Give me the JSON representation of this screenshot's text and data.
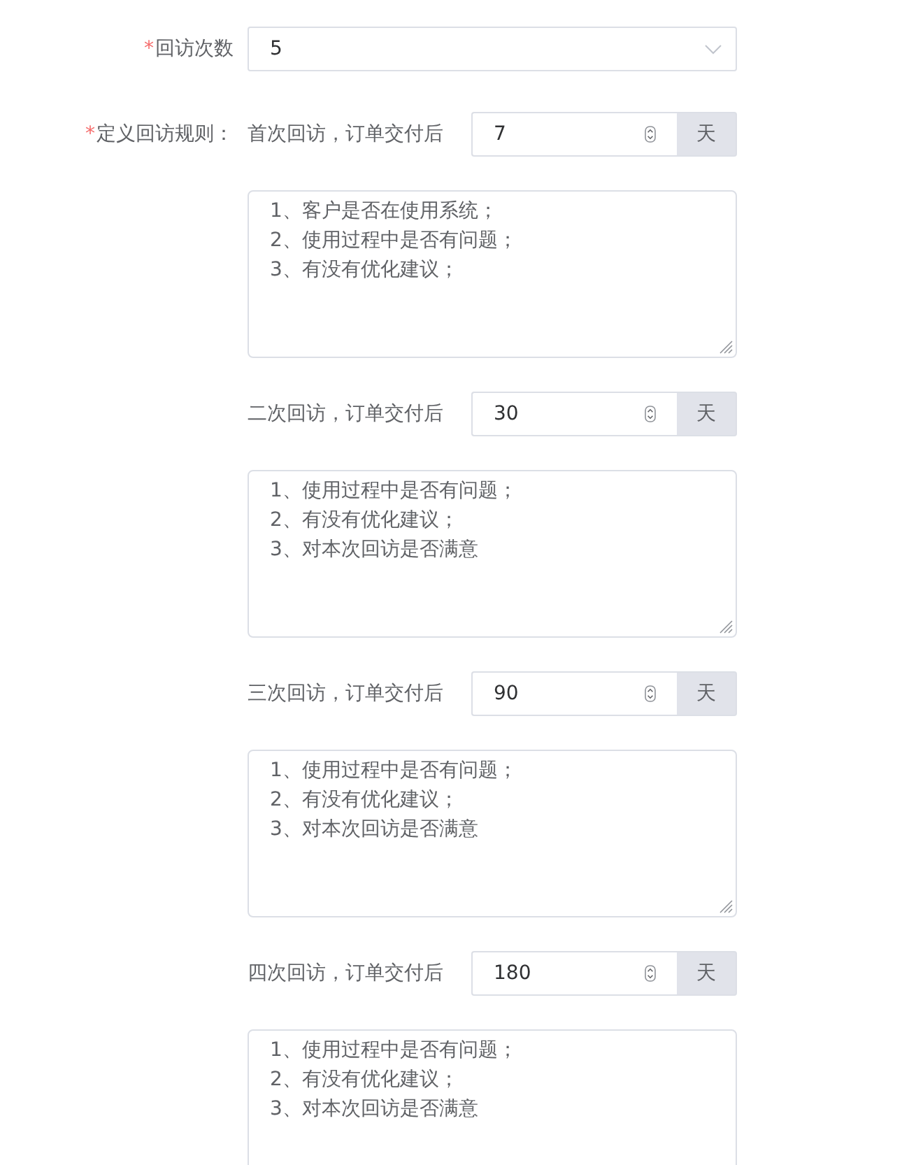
{
  "visit_count": {
    "required_mark": "*",
    "label": "回访次数",
    "value": "5"
  },
  "visit_rules": {
    "required_mark": "*",
    "label": "定义回访规则：",
    "items": [
      {
        "label": "首次回访，订单交付后",
        "days": "7",
        "unit": "天",
        "content": "1、客户是否在使用系统；\n2、使用过程中是否有问题；\n3、有没有优化建议；"
      },
      {
        "label": "二次回访，订单交付后",
        "days": "30",
        "unit": "天",
        "content": "1、使用过程中是否有问题；\n2、有没有优化建议；\n3、对本次回访是否满意"
      },
      {
        "label": "三次回访，订单交付后",
        "days": "90",
        "unit": "天",
        "content": "1、使用过程中是否有问题；\n2、有没有优化建议；\n3、对本次回访是否满意"
      },
      {
        "label": "四次回访，订单交付后",
        "days": "180",
        "unit": "天",
        "content": "1、使用过程中是否有问题；\n2、有没有优化建议；\n3、对本次回访是否满意"
      }
    ]
  }
}
